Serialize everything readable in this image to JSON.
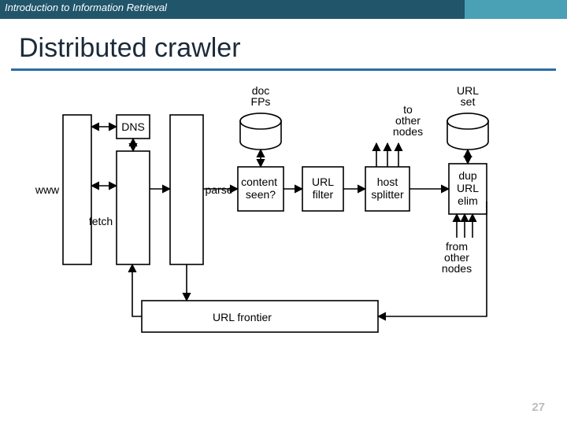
{
  "header": {
    "course": "Introduction to Information Retrieval"
  },
  "slide": {
    "title": "Distributed crawler",
    "page": "27"
  },
  "labels": {
    "www": "www",
    "dns": "DNS",
    "fetch": "fetch",
    "parse": "parse",
    "content_seen": "content\nseen?",
    "doc_fps": "doc\nFPs",
    "url_filter": "URL\nfilter",
    "host_splitter": "host\nsplitter",
    "to_other": "to\nother\nnodes",
    "dup_url_elim": "dup\nURL\nelim",
    "url_set": "URL\nset",
    "from_other": "from\nother\nnodes",
    "url_frontier": "URL frontier"
  }
}
